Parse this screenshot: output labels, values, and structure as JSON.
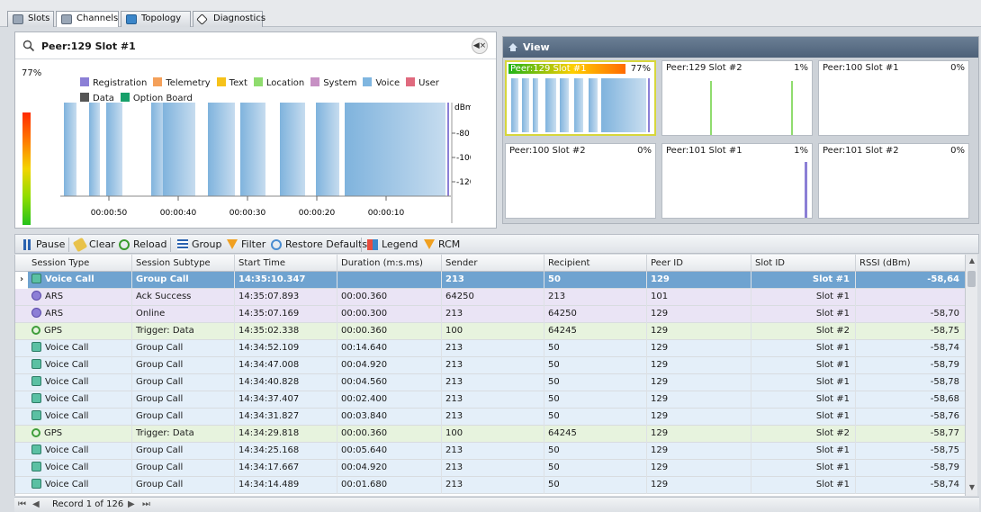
{
  "tabs": [
    {
      "label": "Slots",
      "icon": "slots-icon"
    },
    {
      "label": "Channels",
      "icon": "channels-icon"
    },
    {
      "label": "Topology",
      "icon": "topology-icon"
    },
    {
      "label": "Diagnostics",
      "icon": "diagnostics-icon"
    }
  ],
  "active_tab": "Channels",
  "channel_panel": {
    "title": "Peer:129 Slot #1",
    "level_label": "77%",
    "legend": [
      {
        "label": "Registration",
        "color": "#8b7fd6"
      },
      {
        "label": "Telemetry",
        "color": "#f4a05a"
      },
      {
        "label": "Text",
        "color": "#f6c21a"
      },
      {
        "label": "Location",
        "color": "#8fdc6e"
      },
      {
        "label": "System",
        "color": "#c790c4"
      },
      {
        "label": "Voice",
        "color": "#7fb6e0"
      },
      {
        "label": "User",
        "color": "#e06a7e"
      },
      {
        "label": "Data",
        "color": "#555555"
      },
      {
        "label": "Option Board",
        "color": "#17a06a"
      }
    ],
    "y_unit": "dBm",
    "y_ticks": [
      "-80",
      "-100",
      "-120"
    ],
    "x_ticks": [
      "00:00:50",
      "00:00:40",
      "00:00:30",
      "00:00:20",
      "00:00:10"
    ]
  },
  "view_panel": {
    "title": "View",
    "tiles": [
      {
        "name": "Peer:129 Slot #1",
        "pct": "77%"
      },
      {
        "name": "Peer:129 Slot #2",
        "pct": "1%"
      },
      {
        "name": "Peer:100 Slot #1",
        "pct": "0%"
      },
      {
        "name": "Peer:100 Slot #2",
        "pct": "0%"
      },
      {
        "name": "Peer:101 Slot #1",
        "pct": "1%"
      },
      {
        "name": "Peer:101 Slot #2",
        "pct": "0%"
      }
    ]
  },
  "toolbar": {
    "pause": "Pause",
    "clear": "Clear",
    "reload": "Reload",
    "group": "Group",
    "filter": "Filter",
    "restore": "Restore Defaults",
    "legend": "Legend",
    "rcm": "RCM"
  },
  "grid": {
    "columns": [
      "Session Type",
      "Session Subtype",
      "Start Time",
      "Duration (m:s.ms)",
      "Sender",
      "Recipient",
      "Peer ID",
      "Slot ID",
      "RSSI (dBm)"
    ],
    "rows": [
      {
        "type": "Voice Call",
        "subtype": "Group Call",
        "start": "14:35:10.347",
        "duration": "",
        "sender": "213",
        "recipient": "50",
        "peer": "129",
        "slot": "Slot #1",
        "rssi": "-58,64",
        "kind": "voice",
        "selected": true
      },
      {
        "type": "ARS",
        "subtype": "Ack Success",
        "start": "14:35:07.893",
        "duration": "00:00.360",
        "sender": "64250",
        "recipient": "213",
        "peer": "101",
        "slot": "Slot #1",
        "rssi": "",
        "kind": "ars"
      },
      {
        "type": "ARS",
        "subtype": "Online",
        "start": "14:35:07.169",
        "duration": "00:00.300",
        "sender": "213",
        "recipient": "64250",
        "peer": "129",
        "slot": "Slot #1",
        "rssi": "-58,70",
        "kind": "ars"
      },
      {
        "type": "GPS",
        "subtype": "Trigger: Data",
        "start": "14:35:02.338",
        "duration": "00:00.360",
        "sender": "100",
        "recipient": "64245",
        "peer": "129",
        "slot": "Slot #2",
        "rssi": "-58,75",
        "kind": "gps"
      },
      {
        "type": "Voice Call",
        "subtype": "Group Call",
        "start": "14:34:52.109",
        "duration": "00:14.640",
        "sender": "213",
        "recipient": "50",
        "peer": "129",
        "slot": "Slot #1",
        "rssi": "-58,74",
        "kind": "voice"
      },
      {
        "type": "Voice Call",
        "subtype": "Group Call",
        "start": "14:34:47.008",
        "duration": "00:04.920",
        "sender": "213",
        "recipient": "50",
        "peer": "129",
        "slot": "Slot #1",
        "rssi": "-58,79",
        "kind": "voice"
      },
      {
        "type": "Voice Call",
        "subtype": "Group Call",
        "start": "14:34:40.828",
        "duration": "00:04.560",
        "sender": "213",
        "recipient": "50",
        "peer": "129",
        "slot": "Slot #1",
        "rssi": "-58,78",
        "kind": "voice"
      },
      {
        "type": "Voice Call",
        "subtype": "Group Call",
        "start": "14:34:37.407",
        "duration": "00:02.400",
        "sender": "213",
        "recipient": "50",
        "peer": "129",
        "slot": "Slot #1",
        "rssi": "-58,68",
        "kind": "voice"
      },
      {
        "type": "Voice Call",
        "subtype": "Group Call",
        "start": "14:34:31.827",
        "duration": "00:03.840",
        "sender": "213",
        "recipient": "50",
        "peer": "129",
        "slot": "Slot #1",
        "rssi": "-58,76",
        "kind": "voice"
      },
      {
        "type": "GPS",
        "subtype": "Trigger: Data",
        "start": "14:34:29.818",
        "duration": "00:00.360",
        "sender": "100",
        "recipient": "64245",
        "peer": "129",
        "slot": "Slot #2",
        "rssi": "-58,77",
        "kind": "gps"
      },
      {
        "type": "Voice Call",
        "subtype": "Group Call",
        "start": "14:34:25.168",
        "duration": "00:05.640",
        "sender": "213",
        "recipient": "50",
        "peer": "129",
        "slot": "Slot #1",
        "rssi": "-58,75",
        "kind": "voice"
      },
      {
        "type": "Voice Call",
        "subtype": "Group Call",
        "start": "14:34:17.667",
        "duration": "00:04.920",
        "sender": "213",
        "recipient": "50",
        "peer": "129",
        "slot": "Slot #1",
        "rssi": "-58,79",
        "kind": "voice"
      },
      {
        "type": "Voice Call",
        "subtype": "Group Call",
        "start": "14:34:14.489",
        "duration": "00:01.680",
        "sender": "213",
        "recipient": "50",
        "peer": "129",
        "slot": "Slot #1",
        "rssi": "-58,74",
        "kind": "voice"
      }
    ]
  },
  "footer": {
    "record_text": "Record 1 of 126"
  }
}
